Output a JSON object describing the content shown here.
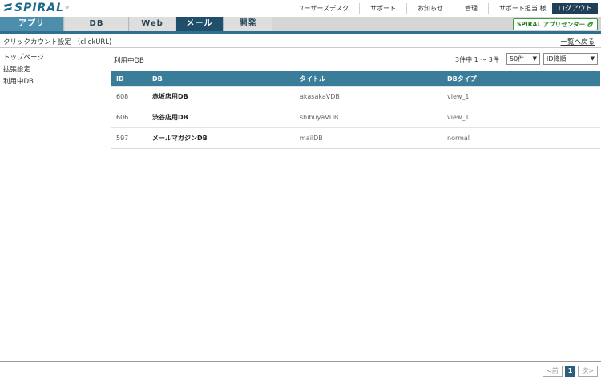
{
  "brand": {
    "name": "SPIRAL",
    "reg_mark": "®",
    "color": "#1b6a8e"
  },
  "header": {
    "links": [
      "ユーザーズデスク",
      "サポート",
      "お知らせ",
      "管理",
      "サポート担当 様"
    ],
    "logout_label": "ログアウト"
  },
  "tabs": {
    "app": "アプリ",
    "db": "DB",
    "web": "Web",
    "mail": "メール",
    "dev": "開発",
    "active": "mail"
  },
  "app_center": {
    "label": "SPIRAL アプリセンター",
    "icon": "leaf-icon"
  },
  "breadcrumb": {
    "text": "クリックカウント設定 （clickURL)",
    "back_label": "一覧へ戻る"
  },
  "sidebar": {
    "items": [
      {
        "label": "トップページ"
      },
      {
        "label": "拡張設定"
      },
      {
        "label": "利用中DB"
      }
    ]
  },
  "main": {
    "title": "利用中DB",
    "count_text": "3件中 1 ～ 3件",
    "per_page": "50件",
    "sort": "ID降順"
  },
  "table": {
    "headers": {
      "id": "ID",
      "db": "DB",
      "title": "タイトル",
      "type": "DBタイプ"
    },
    "rows": [
      {
        "id": "608",
        "db": "赤坂店用DB",
        "title": "akasakaVDB",
        "type": "view_1"
      },
      {
        "id": "606",
        "db": "渋谷店用DB",
        "title": "shibuyaVDB",
        "type": "view_1"
      },
      {
        "id": "597",
        "db": "メールマガジンDB",
        "title": "mailDB",
        "type": "normal"
      }
    ]
  },
  "pager": {
    "prev": "<前",
    "current": "1",
    "next": "次>"
  },
  "colors": {
    "accent_dark": "#1f4f6b",
    "accent": "#3a7d9a",
    "app_tab": "#4d8eac",
    "logout": "#1f3f56",
    "app_center_green": "#3e9a3e"
  }
}
